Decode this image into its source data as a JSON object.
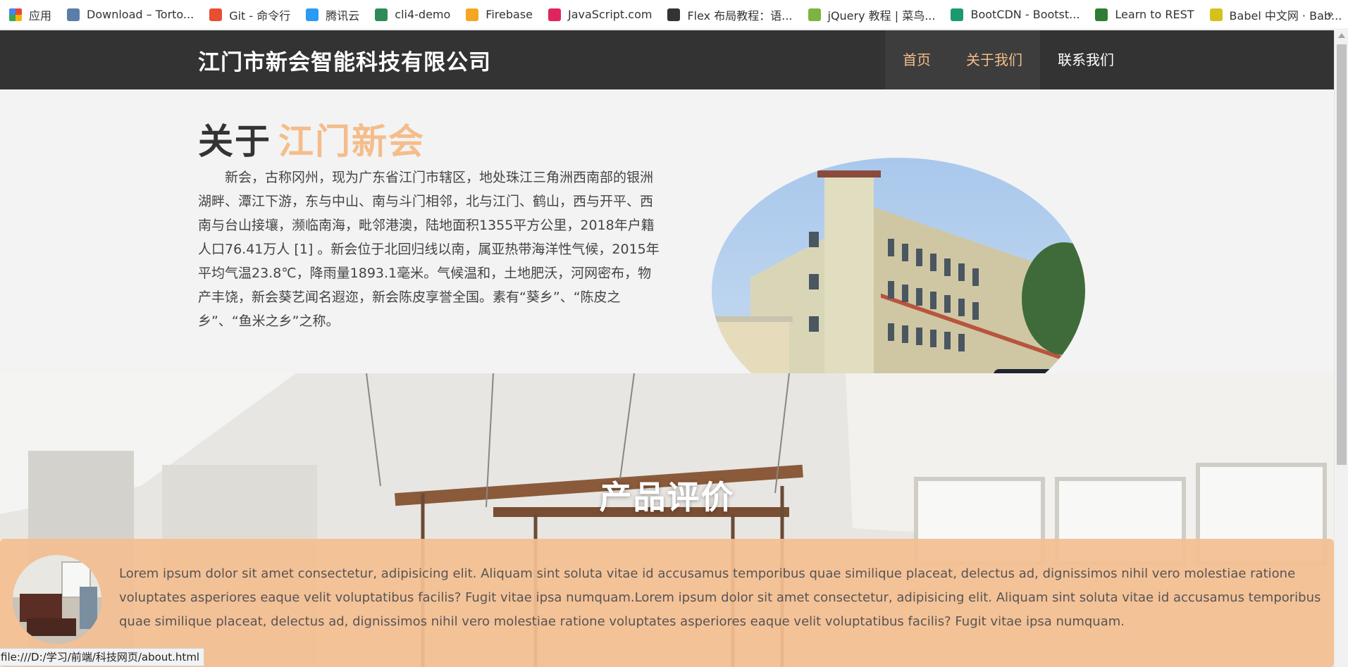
{
  "bookmarks": [
    {
      "label": "应用",
      "icon": "apps-grid-icon",
      "color": "#e8453c"
    },
    {
      "label": "Download – Torto...",
      "icon": "tortoise-icon",
      "color": "#5b7ea8"
    },
    {
      "label": "Git - 命令行",
      "icon": "git-icon",
      "color": "#e84e31"
    },
    {
      "label": "腾讯云",
      "icon": "tencent-cloud-icon",
      "color": "#2b9af3"
    },
    {
      "label": "cli4-demo",
      "icon": "vue-icon",
      "color": "#2e8b57"
    },
    {
      "label": "Firebase",
      "icon": "firebase-icon",
      "color": "#f5a623"
    },
    {
      "label": "JavaScript.com",
      "icon": "javascript-icon",
      "color": "#e0245e"
    },
    {
      "label": "Flex 布局教程：语...",
      "icon": "ruanyifeng-icon",
      "color": "#333333"
    },
    {
      "label": "jQuery 教程 | 菜鸟...",
      "icon": "runoob-icon",
      "color": "#7cb342"
    },
    {
      "label": "BootCDN - Bootst...",
      "icon": "bootcdn-icon",
      "color": "#1c9a6c"
    },
    {
      "label": "Learn to REST",
      "icon": "rest-icon",
      "color": "#2e7d32"
    },
    {
      "label": "Babel 中文网 · Bab...",
      "icon": "babel-icon",
      "color": "#d4c21c"
    }
  ],
  "bookmarks_more": "»",
  "navbar": {
    "brand": "江门市新会智能科技有限公司",
    "links": [
      {
        "label": "首页",
        "active": true
      },
      {
        "label": "关于我们",
        "active": true
      },
      {
        "label": "联系我们",
        "active": false
      }
    ]
  },
  "about": {
    "title_prefix": "关于",
    "title_accent": "江门新会",
    "text": "新会，古称冈州，现为广东省江门市辖区，地处珠江三角洲西南部的银洲湖畔、潭江下游，东与中山、南与斗门相邻，北与江门、鹤山，西与开平、西南与台山接壤，濒临南海，毗邻港澳，陆地面积1355平方公里，2018年户籍人口76.41万人 [1] 。新会位于北回归线以南，属亚热带海洋性气候，2015年平均气温23.8℃，降雨量1893.1毫米。气候温和，土地肥沃，河网密布，物产丰饶，新会葵艺闻名遐迩，新会陈皮享誉全国。素有“葵乡”、“陈皮之乡”、“鱼米之乡”之称。"
  },
  "reviews": {
    "title": "产品评价",
    "text": "Lorem ipsum dolor sit amet consectetur, adipisicing elit. Aliquam sint soluta vitae id accusamus temporibus quae similique placeat, delectus ad, dignissimos nihil vero molestiae ratione voluptates asperiores eaque velit voluptatibus facilis? Fugit vitae ipsa numquam.Lorem ipsum dolor sit amet consectetur, adipisicing elit. Aliquam sint soluta vitae id accusamus temporibus quae similique placeat, delectus ad, dignissimos nihil vero molestiae ratione voluptates asperiores eaque velit voluptatibus facilis? Fugit vitae ipsa numquam."
  },
  "status_url": "file:///D:/学习/前端/科技网页/about.html",
  "colors": {
    "accent": "#f4bd8b",
    "navbar": "#333333",
    "review_bg": "#f4be91"
  }
}
